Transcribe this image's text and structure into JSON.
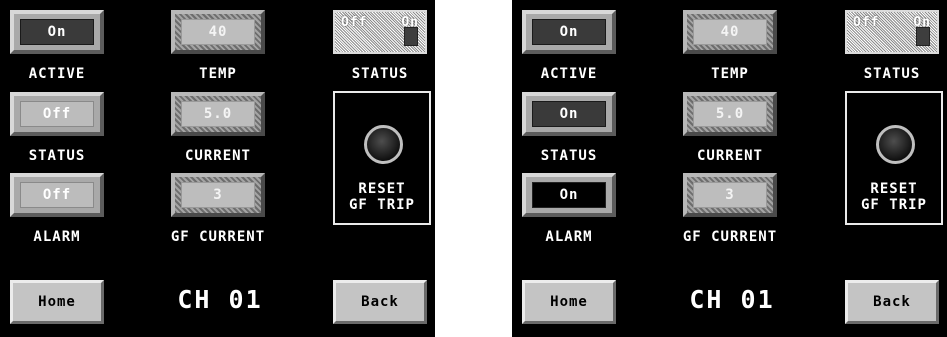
{
  "left": {
    "active_value": "On",
    "active_label": "ACTIVE",
    "temp_value": "40",
    "temp_label": "TEMP",
    "status_toggle_off": "Off",
    "status_toggle_on": "On",
    "status_top_label": "STATUS",
    "status_value": "Off",
    "status_label": "STATUS",
    "current_value": "5.0",
    "current_label": "CURRENT",
    "reset_line1": "RESET",
    "reset_line2": "GF TRIP",
    "alarm_value": "Off",
    "alarm_label": "ALARM",
    "gf_current_value": "3",
    "gf_current_label": "GF CURRENT",
    "home_label": "Home",
    "channel": "CH 01",
    "back_label": "Back"
  },
  "right": {
    "active_value": "On",
    "active_label": "ACTIVE",
    "temp_value": "40",
    "temp_label": "TEMP",
    "status_toggle_off": "Off",
    "status_toggle_on": "On",
    "status_top_label": "STATUS",
    "status_value": "On",
    "status_label": "STATUS",
    "current_value": "5.0",
    "current_label": "CURRENT",
    "reset_line1": "RESET",
    "reset_line2": "GF TRIP",
    "alarm_value": "On",
    "alarm_label": "ALARM",
    "gf_current_value": "3",
    "gf_current_label": "GF CURRENT",
    "home_label": "Home",
    "channel": "CH 01",
    "back_label": "Back"
  },
  "colors": {
    "screen_bg": "#000000",
    "indicator_on": "#3a3a3a",
    "indicator_off": "#bcbcbc",
    "alarm_on": "#000000",
    "text": "#ffffff"
  }
}
